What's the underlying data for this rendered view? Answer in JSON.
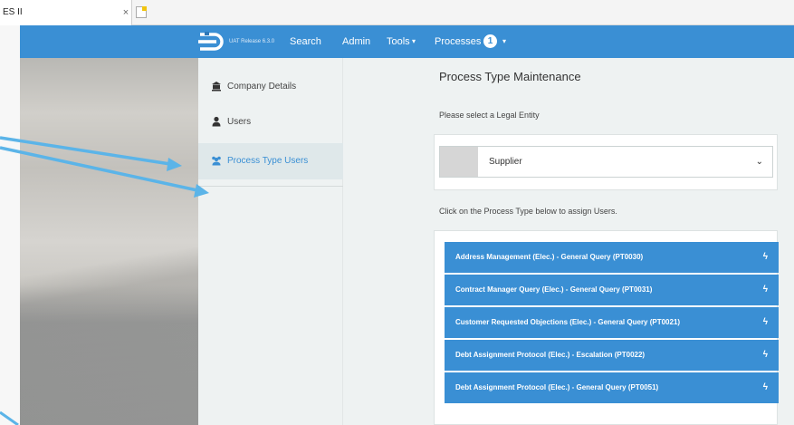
{
  "browser": {
    "tab_title": "ES II",
    "tab_close": "×"
  },
  "navbar": {
    "release": "UAT Release 6.3.0",
    "items": [
      "Search",
      "Admin",
      "Tools",
      "Processes"
    ],
    "processes_badge": "1",
    "caret": "▾"
  },
  "sidebar": {
    "items": [
      {
        "label": "Company Details",
        "icon": "building-icon"
      },
      {
        "label": "Users",
        "icon": "user-icon"
      },
      {
        "label": "Process Type Users",
        "icon": "users-icon",
        "active": true
      }
    ]
  },
  "main": {
    "title": "Process Type Maintenance",
    "legal_entity_label": "Please select a Legal Entity",
    "select_value": "Supplier",
    "select_chevron": "⌄",
    "assign_label": "Click on the Process Type below to assign Users.",
    "processes": [
      "Address Management (Elec.) - General Query (PT0030)",
      "Contract Manager Query (Elec.) - General Query (PT0031)",
      "Customer Requested Objections (Elec.) - General Query (PT0021)",
      "Debt Assignment Protocol (Elec.) - Escalation (PT0022)",
      "Debt Assignment Protocol (Elec.) - General Query (PT0051)"
    ],
    "bolt": "ϟ"
  },
  "colors": {
    "primary": "#3a8fd4",
    "panel_bg": "#eef2f2",
    "arrow": "#5bb4e8"
  }
}
